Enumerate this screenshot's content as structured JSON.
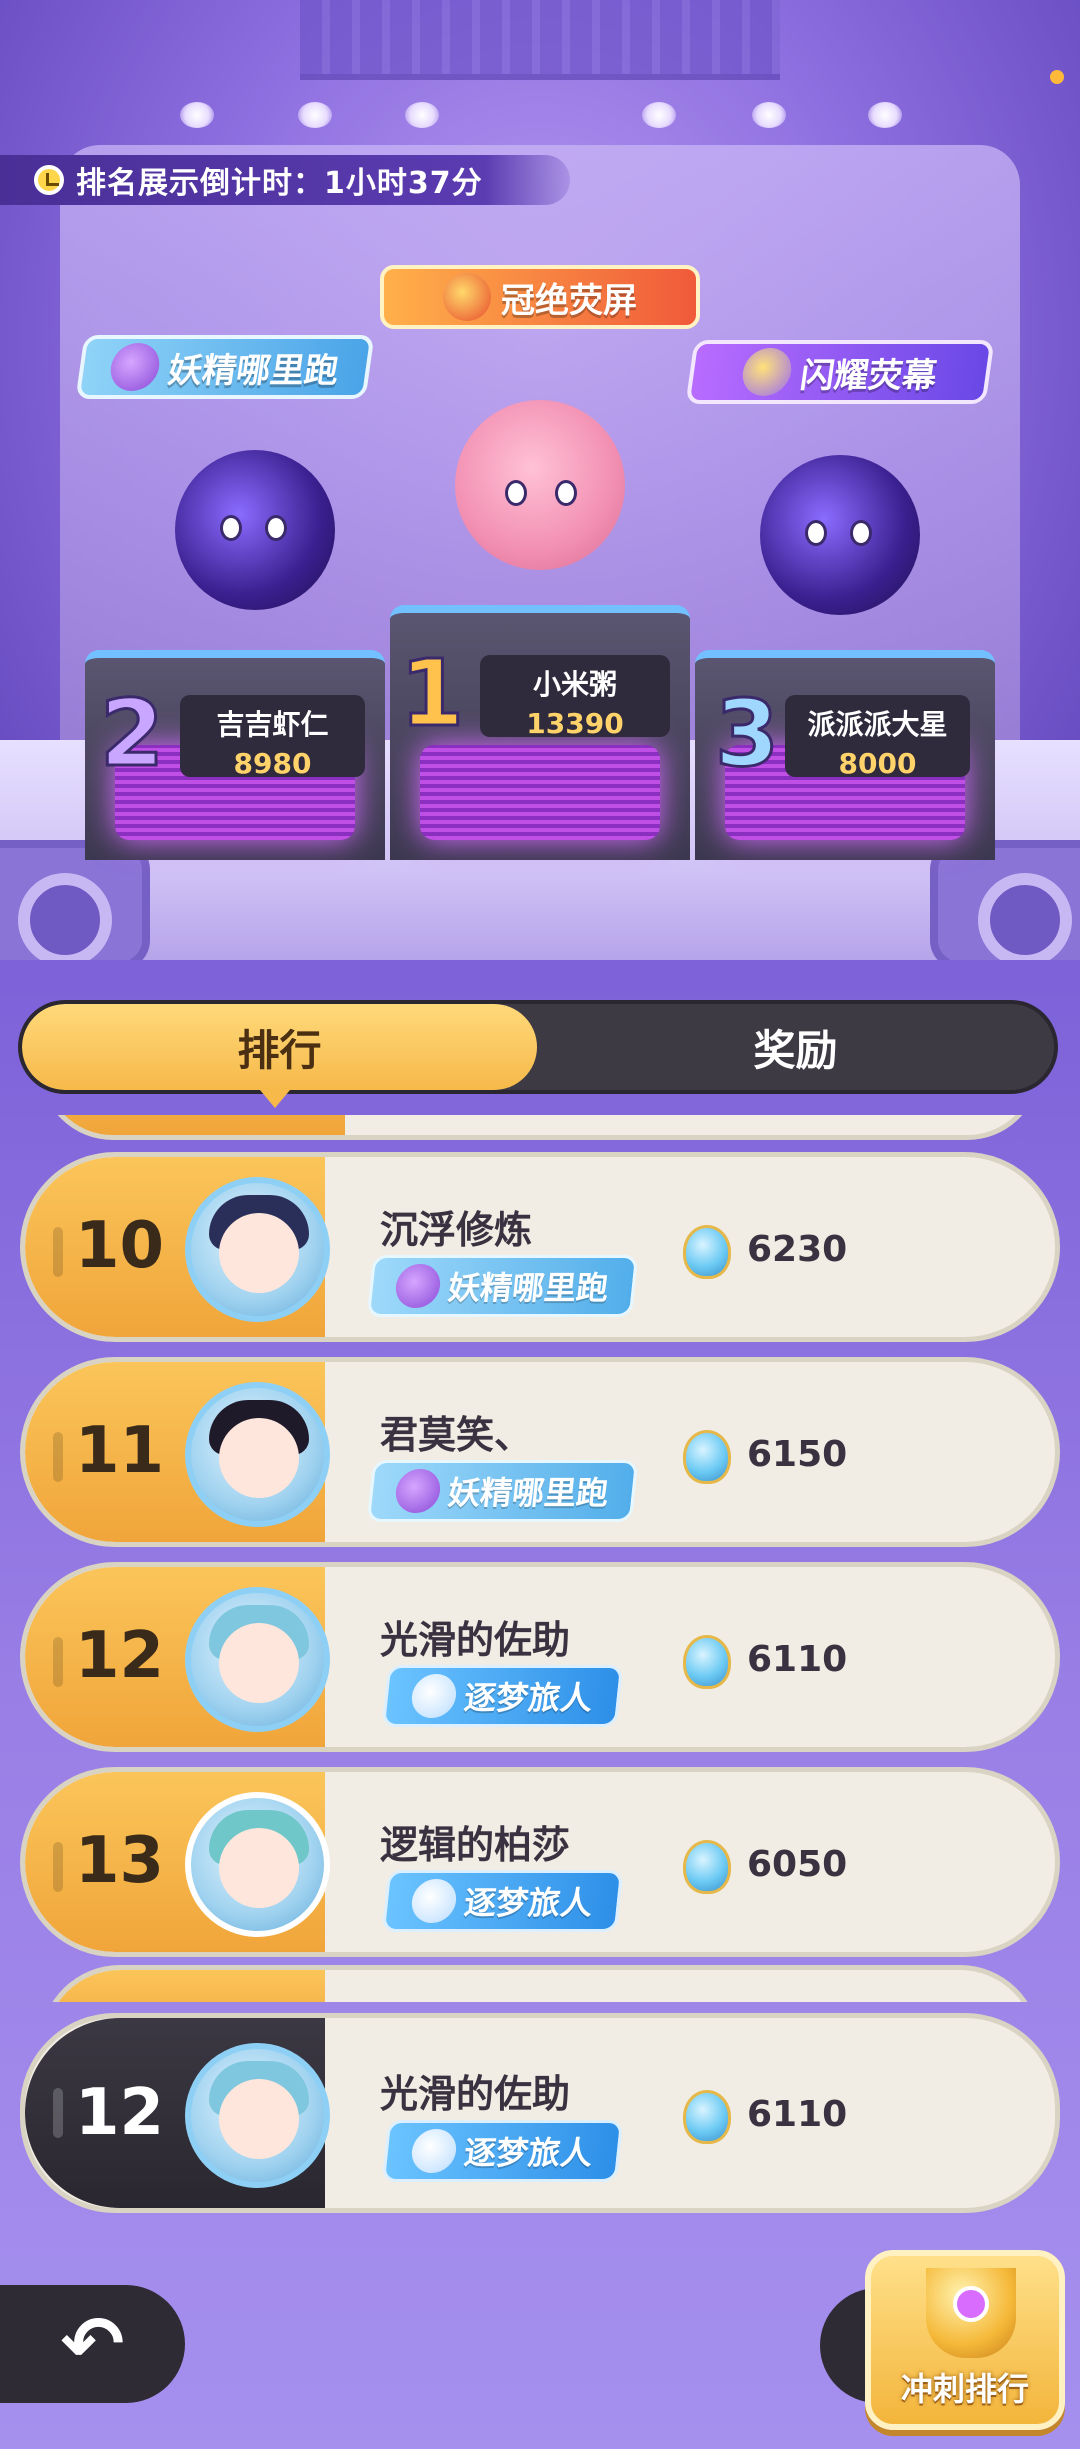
{
  "countdown": {
    "label": "排名展示倒计时：1小时37分",
    "icon": "clock-icon"
  },
  "podium": {
    "badges": {
      "left": "妖精哪里跑",
      "center": "冠绝荧屏",
      "right": "闪耀荧幕"
    },
    "first": {
      "rank": "1",
      "name": "小米粥",
      "score": "13390"
    },
    "second": {
      "rank": "2",
      "name": "吉吉虾仁",
      "score": "8980"
    },
    "third": {
      "rank": "3",
      "name": "派派派大星",
      "score": "8000"
    }
  },
  "tabs": [
    {
      "label": "排行",
      "active": true
    },
    {
      "label": "奖励",
      "active": false
    }
  ],
  "list": [
    {
      "rank": "10",
      "name": "沉浮修炼",
      "tag": "妖精哪里跑",
      "tag_type": "fairy",
      "score": "6230",
      "hair_color": "#2a2f5a"
    },
    {
      "rank": "11",
      "name": "君莫笑、",
      "tag": "妖精哪里跑",
      "tag_type": "fairy",
      "score": "6150",
      "hair_color": "#1f1a2a"
    },
    {
      "rank": "12",
      "name": "光滑的佐助",
      "tag": "逐梦旅人",
      "tag_type": "dream",
      "score": "6110",
      "hair_color": "#7fc7de"
    },
    {
      "rank": "13",
      "name": "逻辑的柏莎",
      "tag": "逐梦旅人",
      "tag_type": "dream",
      "score": "6050",
      "hair_color": "#6fc7c9"
    }
  ],
  "my_rank": {
    "rank": "12",
    "name": "光滑的佐助",
    "tag": "逐梦旅人",
    "score": "6110"
  },
  "buttons": {
    "back_icon": "back-arrow-icon",
    "sprint_label": "冲刺排行"
  },
  "colors": {
    "accent": "#f6b94a",
    "tab_dark": "#3d3a44",
    "background": "#7d62d9"
  }
}
